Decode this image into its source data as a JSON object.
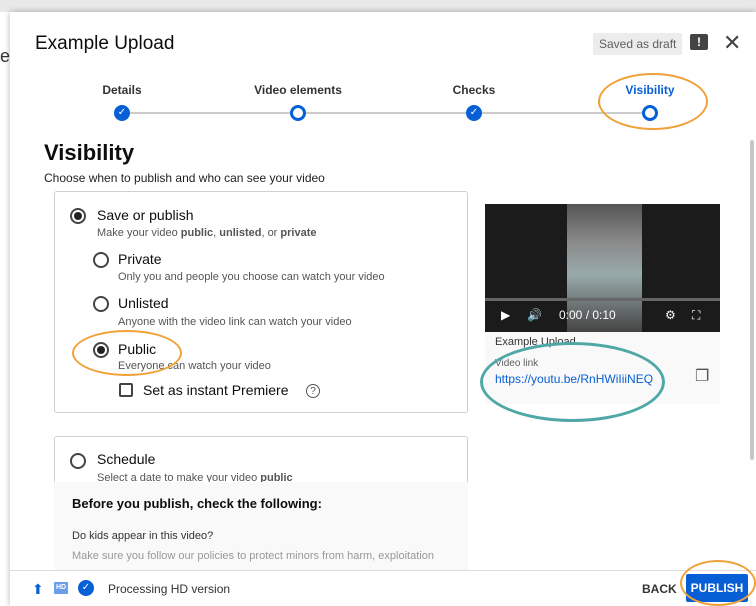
{
  "backdrop": {
    "fragment": "el"
  },
  "dialog": {
    "title": "Example Upload",
    "draft_label": "Saved as draft",
    "feedback_icon": "feedback-icon",
    "close_icon": "close-icon"
  },
  "steps": [
    {
      "label": "Details",
      "state": "done"
    },
    {
      "label": "Video elements",
      "state": "current"
    },
    {
      "label": "Checks",
      "state": "done"
    },
    {
      "label": "Visibility",
      "state": "active"
    }
  ],
  "visibility": {
    "title": "Visibility",
    "subtitle": "Choose when to publish and who can see your video",
    "save_publish": {
      "title": "Save or publish",
      "desc_prefix": "Make your video ",
      "desc_public": "public",
      "desc_sep1": ", ",
      "desc_unlisted": "unlisted",
      "desc_sep2": ", or ",
      "desc_private": "private"
    },
    "options": [
      {
        "title": "Private",
        "desc": "Only you and people you choose can watch your video",
        "selected": false
      },
      {
        "title": "Unlisted",
        "desc": "Anyone with the video link can watch your video",
        "selected": false
      },
      {
        "title": "Public",
        "desc": "Everyone can watch your video",
        "selected": true
      }
    ],
    "premiere_label": "Set as instant Premiere",
    "schedule": {
      "title": "Schedule",
      "desc_prefix": "Select a date to make your video ",
      "desc_bold": "public"
    }
  },
  "checklist": {
    "title": "Before you publish, check the following:",
    "question": "Do kids appear in this video?",
    "cutoff": "Make sure you follow our policies to protect minors from harm, exploitation"
  },
  "video": {
    "time": "0:00 / 0:10",
    "name": "Example Upload",
    "link_label": "Video link",
    "link": "https://youtu.be/RnHWiIiiNEQ"
  },
  "footer": {
    "status": "Processing HD version",
    "hd_badge": "HD",
    "back_label": "BACK",
    "publish_label": "PUBLISH"
  },
  "colors": {
    "accent": "#065fd4",
    "annotation_orange": "#f0a13a",
    "annotation_teal": "#4fa8a6"
  }
}
